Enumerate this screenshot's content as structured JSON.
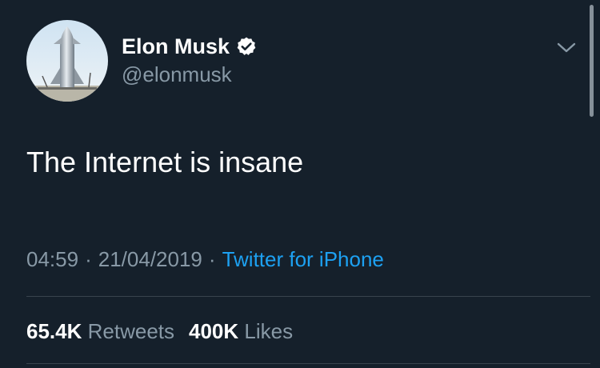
{
  "author": {
    "name": "Elon Musk",
    "handle": "@elonmusk",
    "verified": true,
    "avatar_icon": "starship-avatar-icon"
  },
  "tweet": {
    "text": "The Internet is insane",
    "time": "04:59",
    "date": "21/04/2019",
    "separator": "·",
    "source": "Twitter for iPhone"
  },
  "stats": {
    "retweets_count": "65.4K",
    "retweets_label": "Retweets",
    "likes_count": "400K",
    "likes_label": "Likes"
  },
  "colors": {
    "background": "#15202b",
    "text_primary": "#ffffff",
    "text_secondary": "#8899a6",
    "link": "#1da1f2",
    "divider": "#38444d"
  }
}
